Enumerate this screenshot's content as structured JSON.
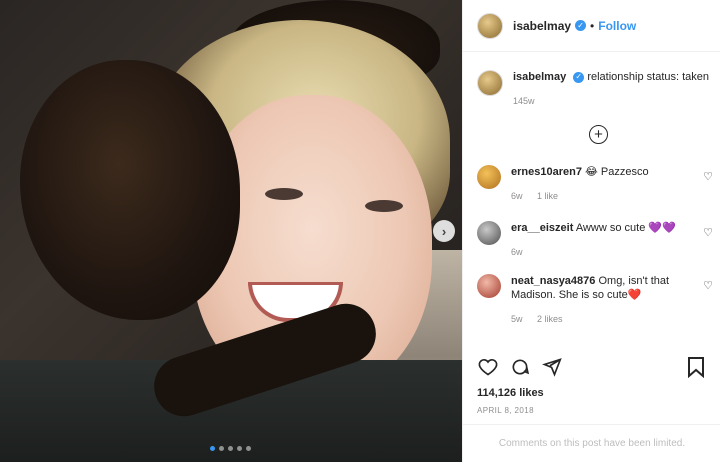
{
  "post": {
    "username": "isabelmay",
    "follow_label": "Follow",
    "separator": "•",
    "caption_text": "relationship status: taken",
    "caption_time": "145w",
    "likes": "114,126 likes",
    "date": "APRIL 8, 2018",
    "comments_limited": "Comments on this post have been limited.",
    "carousel_count": 5,
    "carousel_active": 1
  },
  "comments": [
    {
      "username": "ernes10aren7",
      "text": "😂 Pazzesco",
      "time": "6w",
      "likes": "1 like",
      "avatar_color": "#e8a33a"
    },
    {
      "username": "era__eiszeit",
      "text": "Awww so cute 💜💜",
      "time": "6w",
      "likes": "",
      "avatar_color": "#7a7a7a"
    },
    {
      "username": "neat_nasya4876",
      "text": "Omg, isn't that Madison. She is so cute❤️",
      "time": "5w",
      "likes": "2 likes",
      "avatar_color": "#c44a3c"
    }
  ],
  "colors": {
    "accent": "#3897f0",
    "text": "#262626",
    "muted": "#8e8e8e"
  }
}
